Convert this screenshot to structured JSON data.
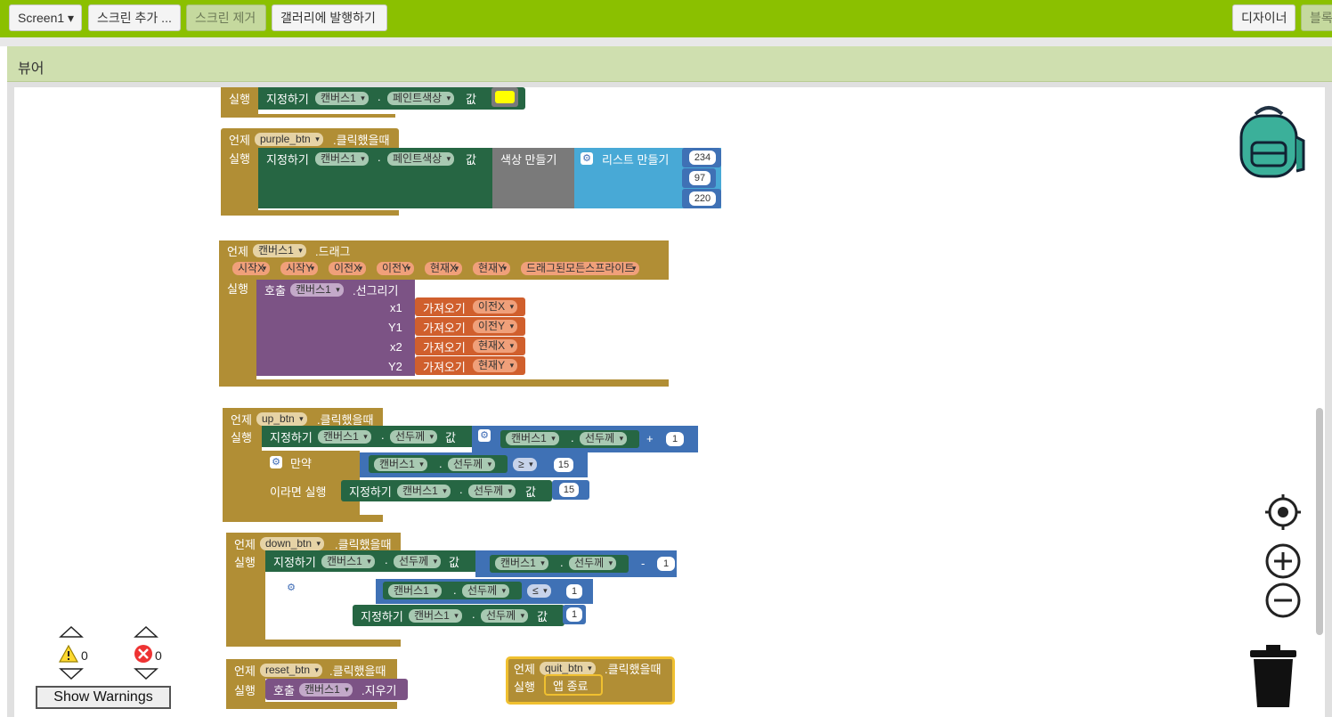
{
  "toolbar": {
    "screen": "Screen1",
    "add_screen": "스크린 추가 ...",
    "remove_screen": "스크린 제거",
    "publish": "갤러리에 발행하기",
    "designer": "디자이너",
    "blocks": "블록"
  },
  "viewer_title": "뷰어",
  "labels": {
    "when": "언제",
    "do": "실행",
    "set": "지정하기",
    "value": "값",
    "dot": ".",
    "call": "호출",
    "get": "가져오기",
    "if": "만약",
    "then": "이라면 실행",
    "clicked": ".클릭했을때",
    "drag": ".드래그",
    "draw_line": ".선그리기",
    "clear": ".지우기",
    "make_color": "색상 만들기",
    "make_list": "리스트 만들기",
    "close_app": "앱 종료",
    "plus": "+",
    "minus": "-",
    "gte": "≥",
    "lte": "≤"
  },
  "components": {
    "canvas": "캔버스1",
    "paint_color": "페인트색상",
    "line_width": "선두께",
    "purple_btn": "purple_btn",
    "up_btn": "up_btn",
    "down_btn": "down_btn",
    "reset_btn": "reset_btn",
    "quit_btn": "quit_btn"
  },
  "drag_params": [
    "시작X",
    "시작Y",
    "이전X",
    "이전Y",
    "현재X",
    "현재Y",
    "드래그된모든스프라이트"
  ],
  "line_args": [
    {
      "name": "x1",
      "var": "이전X"
    },
    {
      "name": "Y1",
      "var": "이전Y"
    },
    {
      "name": "x2",
      "var": "현재X"
    },
    {
      "name": "Y2",
      "var": "현재Y"
    }
  ],
  "numbers": {
    "r": "234",
    "g": "97",
    "b": "220",
    "one": "1",
    "fifteen": "15"
  },
  "colors": {
    "event": "#b18e35",
    "set": "#266643",
    "call": "#7c5385",
    "get": "#d05f2d",
    "math": "#3f71b5",
    "list": "#48a9d6",
    "control": "#b18e35",
    "paint_yellow": "#ffff00"
  },
  "warnings": {
    "warn_count": "0",
    "error_count": "0",
    "show_label": "Show Warnings"
  }
}
